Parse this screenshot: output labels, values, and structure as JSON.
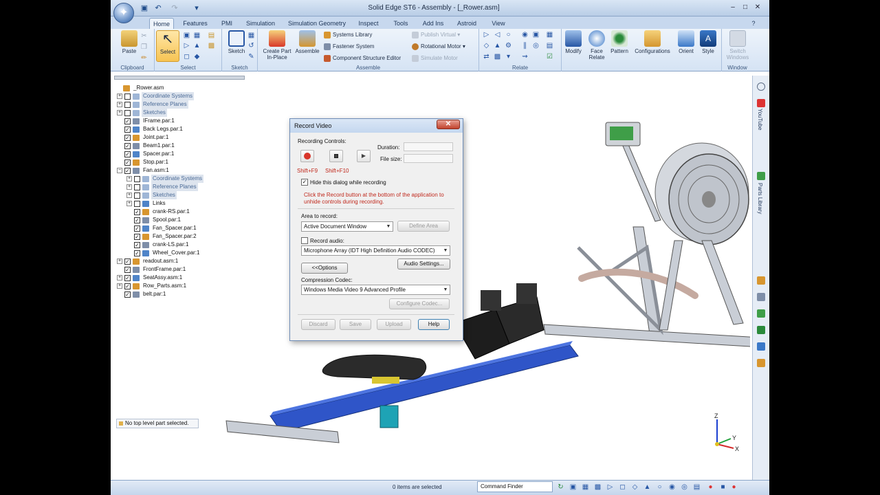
{
  "window": {
    "title": "Solid Edge ST6 - Assembly - [_Rower.asm]",
    "minimize": "–",
    "maximize": "□",
    "close": "✕",
    "help": "?"
  },
  "tabs": [
    "Home",
    "Features",
    "PMI",
    "Simulation",
    "Simulation Geometry",
    "Inspect",
    "Tools",
    "Add Ins",
    "Astroid",
    "View"
  ],
  "ribbon": {
    "clipboard": {
      "label": "Clipboard",
      "paste": "Paste"
    },
    "select": {
      "label": "Select",
      "select": "Select"
    },
    "sketch": {
      "label": "Sketch",
      "sketch": "Sketch"
    },
    "assemble": {
      "label": "Assemble",
      "create_part": "Create Part In-Place",
      "assemble": "Assemble",
      "systems_library": "Systems Library",
      "fastener_system": "Fastener System",
      "component_structure_editor": "Component Structure Editor",
      "publish_virtual": "Publish Virtual",
      "rotational_motor": "Rotational Motor",
      "simulate_motor": "Simulate Motor"
    },
    "relate": {
      "label": "Relate"
    },
    "modify": "Modify",
    "face_relate": "Face Relate",
    "pattern": "Pattern",
    "configurations": "Configurations",
    "orient": "Orient",
    "style": "Style",
    "switch_windows": "Switch Windows",
    "window_label": "Window"
  },
  "tree": [
    {
      "label": "_Rower.asm",
      "indent": 0,
      "exp": "",
      "cb": "",
      "dim": false
    },
    {
      "label": "Coordinate Systems",
      "indent": 1,
      "exp": "+",
      "cb": "",
      "dim": true
    },
    {
      "label": "Reference Planes",
      "indent": 1,
      "exp": "+",
      "cb": "",
      "dim": true
    },
    {
      "label": "Sketches",
      "indent": 1,
      "exp": "+",
      "cb": "",
      "dim": true
    },
    {
      "label": "IFrame.par:1",
      "indent": 1,
      "exp": "",
      "cb": "✓",
      "dim": false
    },
    {
      "label": "Back Legs.par:1",
      "indent": 1,
      "exp": "",
      "cb": "✓",
      "dim": false
    },
    {
      "label": "Joint.par:1",
      "indent": 1,
      "exp": "",
      "cb": "✓",
      "dim": false
    },
    {
      "label": "Beam1.par:1",
      "indent": 1,
      "exp": "",
      "cb": "✓",
      "dim": false
    },
    {
      "label": "Spacer.par:1",
      "indent": 1,
      "exp": "",
      "cb": "✓",
      "dim": false
    },
    {
      "label": "Stop.par:1",
      "indent": 1,
      "exp": "",
      "cb": "✓",
      "dim": false
    },
    {
      "label": "Fan.asm:1",
      "indent": 1,
      "exp": "−",
      "cb": "✓",
      "dim": false
    },
    {
      "label": "Coordinate Systems",
      "indent": 2,
      "exp": "+",
      "cb": "",
      "dim": true
    },
    {
      "label": "Reference Planes",
      "indent": 2,
      "exp": "+",
      "cb": "",
      "dim": true
    },
    {
      "label": "Sketches",
      "indent": 2,
      "exp": "+",
      "cb": "",
      "dim": true
    },
    {
      "label": "Links",
      "indent": 2,
      "exp": "+",
      "cb": "",
      "dim": false
    },
    {
      "label": "crank-RS.par:1",
      "indent": 2,
      "exp": "",
      "cb": "✓",
      "dim": false
    },
    {
      "label": "Spool.par:1",
      "indent": 2,
      "exp": "",
      "cb": "✓",
      "dim": false
    },
    {
      "label": "Fan_Spacer.par:1",
      "indent": 2,
      "exp": "",
      "cb": "✓",
      "dim": false
    },
    {
      "label": "Fan_Spacer.par:2",
      "indent": 2,
      "exp": "",
      "cb": "✓",
      "dim": false
    },
    {
      "label": "crank-LS.par:1",
      "indent": 2,
      "exp": "",
      "cb": "✓",
      "dim": false
    },
    {
      "label": "Wheel_Cover.par:1",
      "indent": 2,
      "exp": "",
      "cb": "✓",
      "dim": false
    },
    {
      "label": "readout.asm:1",
      "indent": 1,
      "exp": "+",
      "cb": "✓",
      "dim": false
    },
    {
      "label": "FrontFrame.par:1",
      "indent": 1,
      "exp": "",
      "cb": "✓",
      "dim": false
    },
    {
      "label": "SeatAssy.asm:1",
      "indent": 1,
      "exp": "+",
      "cb": "✓",
      "dim": false
    },
    {
      "label": "Row_Parts.asm:1",
      "indent": 1,
      "exp": "+",
      "cb": "✓",
      "dim": false
    },
    {
      "label": "belt.par:1",
      "indent": 1,
      "exp": "",
      "cb": "✓",
      "dim": false
    }
  ],
  "status_message": "No top level part selected.",
  "bottom": {
    "items_selected": "0 items are selected",
    "command_finder": "Command Finder"
  },
  "right_rail": {
    "youtube": "YouTube",
    "parts_library": "Parts Library"
  },
  "triad": {
    "z": "Z",
    "y": "Y",
    "x": "X"
  },
  "dialog": {
    "title": "Record Video",
    "close": "✕",
    "recording_controls": "Recording Controls:",
    "duration_label": "Duration:",
    "file_size_label": "File size:",
    "shortcut_record": "Shift+F9",
    "shortcut_stop": "Shift+F10",
    "hide_dialog": "Hide this dialog while recording",
    "hide_dialog_checked": "✓",
    "info_text_1": "Click the Record button at the bottom of the application to",
    "info_text_2": "unhide controls during recording.",
    "area_label": "Area to record:",
    "area_value": "Active Document Window",
    "define_area": "Define Area",
    "record_audio": "Record audio:",
    "audio_device": "Microphone Array (IDT High Definition Audio CODEC)",
    "options": "<<Options",
    "audio_settings": "Audio Settings...",
    "codec_label": "Compression Codec:",
    "codec_value": "Windows Media Video 9 Advanced Profile",
    "configure_codec": "Configure Codec...",
    "discard": "Discard",
    "save": "Save",
    "upload": "Upload",
    "help": "Help"
  },
  "colors": {
    "ribbon_bg": "#dbe7f6",
    "frame_blue": "#1f4fd6",
    "fan_silver": "#c9ced6",
    "record_red": "#d8352a",
    "info_red": "#c0281c"
  }
}
